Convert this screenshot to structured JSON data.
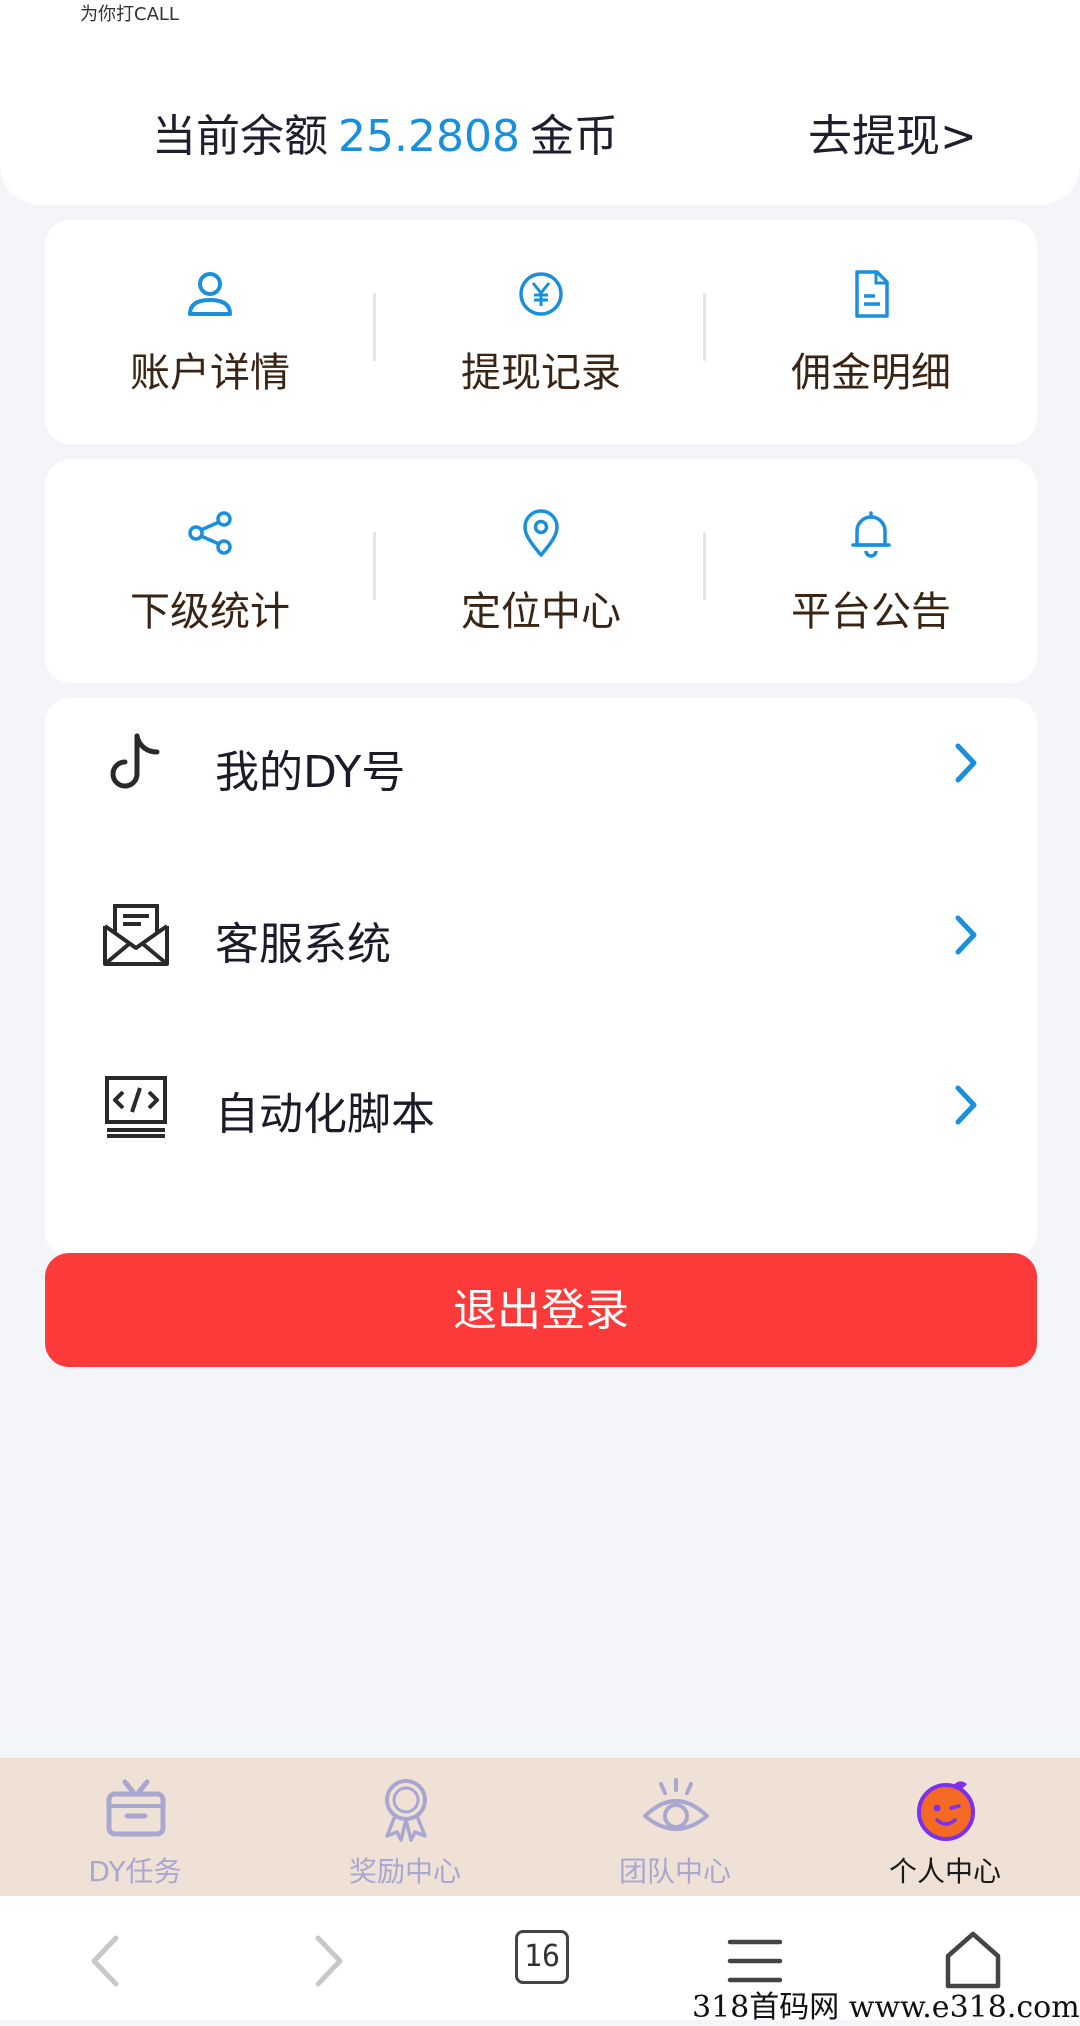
{
  "header": {
    "logo_text": "为你打CALL",
    "balance_label": "当前余额",
    "balance_value": "25.2808",
    "balance_unit": "金币",
    "withdraw_label": "去提现>"
  },
  "grid1": [
    {
      "label": "账户详情",
      "icon": "user-icon"
    },
    {
      "label": "提现记录",
      "icon": "yuan-icon"
    },
    {
      "label": "佣金明细",
      "icon": "document-icon"
    }
  ],
  "grid2": [
    {
      "label": "下级统计",
      "icon": "share-icon"
    },
    {
      "label": "定位中心",
      "icon": "location-pin-icon"
    },
    {
      "label": "平台公告",
      "icon": "bell-icon"
    }
  ],
  "list": [
    {
      "label": "我的DY号",
      "icon": "tiktok-icon"
    },
    {
      "label": "客服系统",
      "icon": "envelope-icon"
    },
    {
      "label": "自动化脚本",
      "icon": "code-icon"
    }
  ],
  "logout_label": "退出登录",
  "tabbar": [
    {
      "label": "DY任务",
      "icon": "gift-box-icon"
    },
    {
      "label": "奖励中心",
      "icon": "medal-icon"
    },
    {
      "label": "团队中心",
      "icon": "eye-icon"
    },
    {
      "label": "个人中心",
      "icon": "orange-face-icon",
      "active": true
    }
  ],
  "browser": {
    "tab_count": "16"
  },
  "watermark": "318首码网  www.e318.com",
  "colors": {
    "accent": "#1a8fdc",
    "logout": "#fc3a3a",
    "tabbar_bg": "#f0e1d7"
  }
}
